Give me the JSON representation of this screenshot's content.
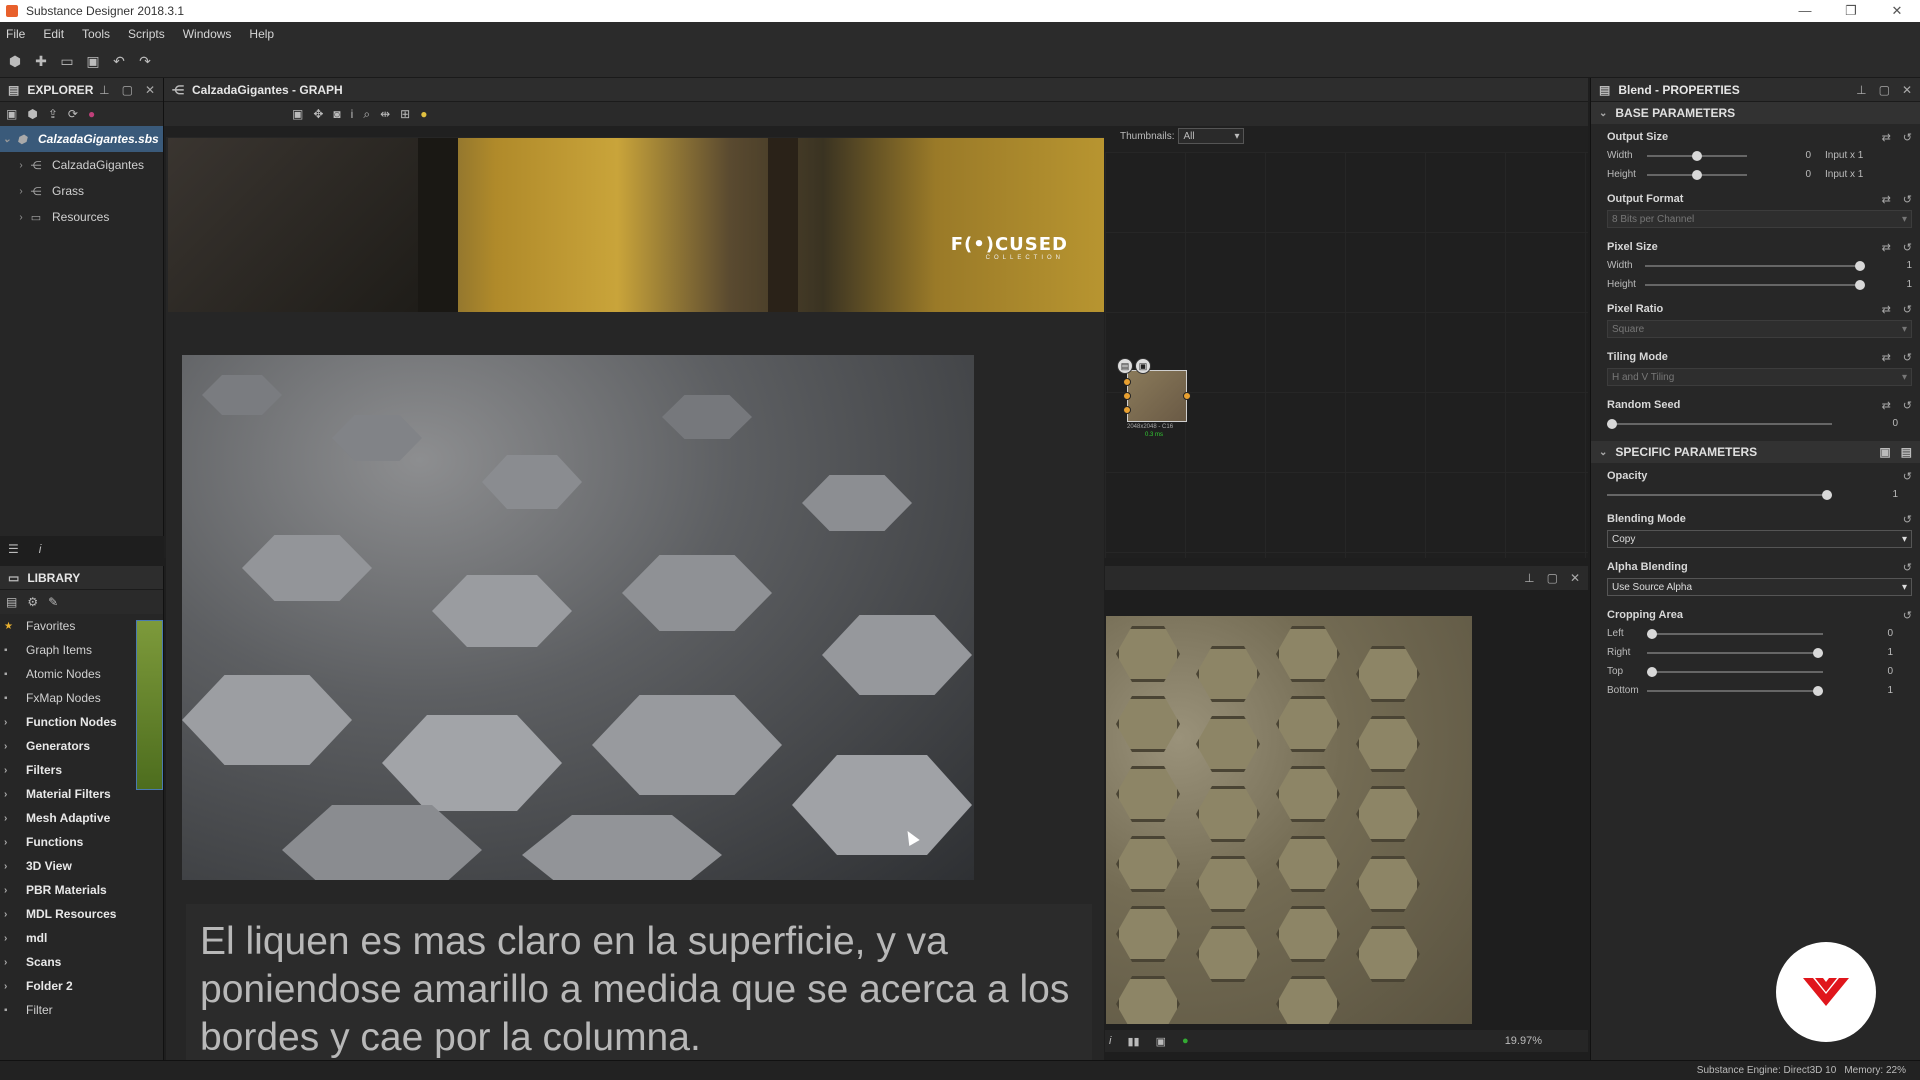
{
  "window": {
    "title": "Substance Designer 2018.3.1",
    "controls": [
      "—",
      "❐",
      "✕"
    ]
  },
  "menu": [
    "File",
    "Edit",
    "Tools",
    "Scripts",
    "Windows",
    "Help"
  ],
  "explorer": {
    "title": "EXPLORER",
    "package": "CalzadaGigantes.sbs",
    "items": [
      "CalzadaGigantes",
      "Grass",
      "Resources"
    ]
  },
  "library": {
    "title": "LIBRARY",
    "items": [
      {
        "label": "Favorites",
        "bold": false
      },
      {
        "label": "Graph Items",
        "bold": false
      },
      {
        "label": "Atomic Nodes",
        "bold": false
      },
      {
        "label": "FxMap Nodes",
        "bold": false
      },
      {
        "label": "Function Nodes",
        "bold": true
      },
      {
        "label": "Generators",
        "bold": true
      },
      {
        "label": "Filters",
        "bold": true
      },
      {
        "label": "Material Filters",
        "bold": true
      },
      {
        "label": "Mesh Adaptive",
        "bold": true
      },
      {
        "label": "Functions",
        "bold": true
      },
      {
        "label": "3D View",
        "bold": true
      },
      {
        "label": "PBR Materials",
        "bold": true
      },
      {
        "label": "MDL Resources",
        "bold": true
      },
      {
        "label": "mdl",
        "bold": true
      },
      {
        "label": "Scans",
        "bold": true
      },
      {
        "label": "Folder 2",
        "bold": true
      },
      {
        "label": "Filter",
        "bold": false
      }
    ]
  },
  "graph": {
    "title": "CalzadaGigantes - GRAPH",
    "thumbnails_label": "Thumbnails:",
    "thumbnails_value": "All",
    "node": {
      "caption": "2048x2048 - C16",
      "time": "0.3 ms"
    }
  },
  "overlay": {
    "brand": "F(•)CUSED",
    "brand_sub": "COLLECTION",
    "caption": "El liquen es mas claro en la superficie, y va poniendose amarillo a medida que se acerca a los bordes y cae por la columna."
  },
  "view2d": {
    "zoom": "19.97%"
  },
  "properties": {
    "title": "Blend - PROPERTIES",
    "base_title": "BASE PARAMETERS",
    "specific_title": "SPECIFIC PARAMETERS",
    "output_size": {
      "label": "Output Size",
      "width_label": "Width",
      "height_label": "Height",
      "width_value": "0",
      "height_value": "0",
      "width_extra": "Input x 1",
      "height_extra": "Input x 1"
    },
    "output_format": {
      "label": "Output Format",
      "value": "8 Bits per Channel"
    },
    "pixel_size": {
      "label": "Pixel Size",
      "width_label": "Width",
      "height_label": "Height",
      "width_value": "1",
      "height_value": "1"
    },
    "pixel_ratio": {
      "label": "Pixel Ratio",
      "value": "Square"
    },
    "tiling_mode": {
      "label": "Tiling Mode",
      "value": "H and V Tiling"
    },
    "random_seed": {
      "label": "Random Seed",
      "value": "0"
    },
    "opacity": {
      "label": "Opacity",
      "value": "1"
    },
    "blending_mode": {
      "label": "Blending Mode",
      "value": "Copy"
    },
    "alpha_blending": {
      "label": "Alpha Blending",
      "value": "Use Source Alpha"
    },
    "cropping": {
      "label": "Cropping Area",
      "rows": [
        {
          "name": "Left",
          "value": "0",
          "level": 0.0
        },
        {
          "name": "Right",
          "value": "1",
          "level": 1.0
        },
        {
          "name": "Top",
          "value": "0",
          "level": 0.0
        },
        {
          "name": "Bottom",
          "value": "1",
          "level": 1.0
        }
      ]
    }
  },
  "status": {
    "engine": "Substance Engine: Direct3D 10",
    "memory": "Memory: 22%"
  },
  "colors": {
    "accent": "#3a5a7a",
    "logo_red": "#e0161c"
  }
}
